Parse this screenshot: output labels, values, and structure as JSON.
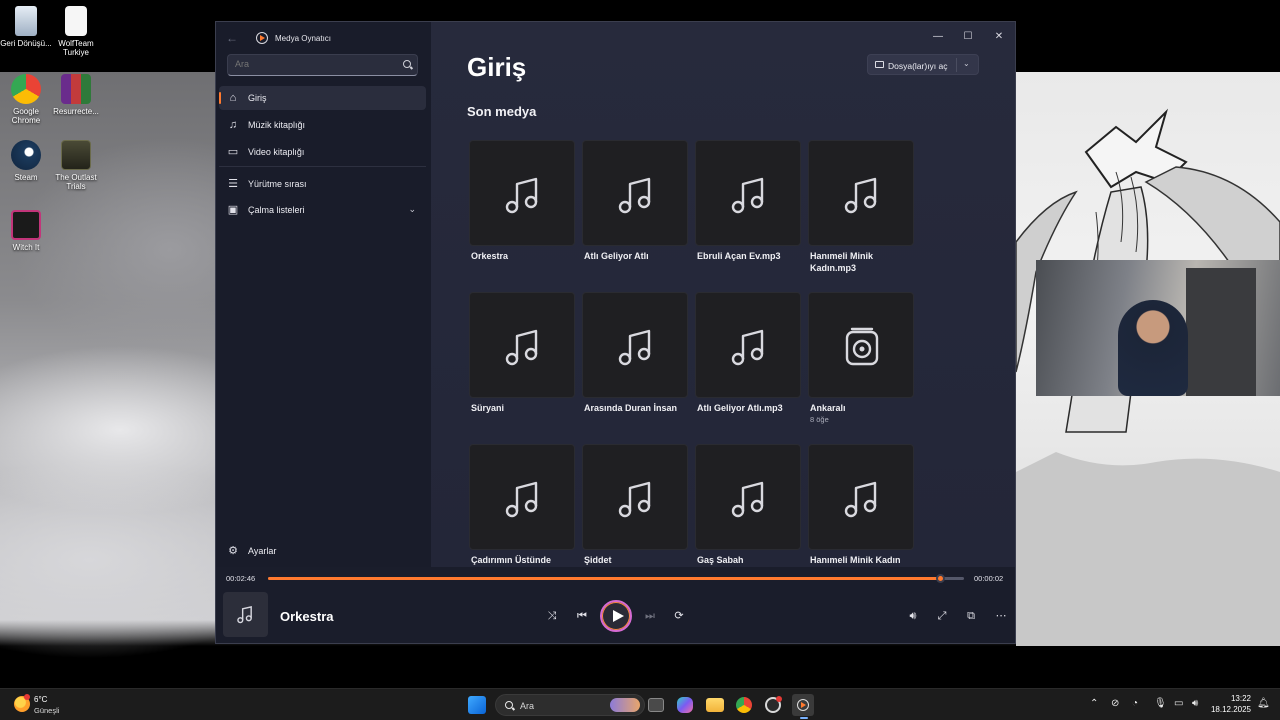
{
  "desktop": {
    "icons": [
      {
        "label": "Geri Dönüşü...",
        "color": "#c9d6e6"
      },
      {
        "label": "WolfTeam Turkiye",
        "color": "#f4f4f4"
      },
      {
        "label": "Google Chrome",
        "color": "#4285f4"
      },
      {
        "label": "Resurrecte...",
        "color": "#b32d5e"
      },
      {
        "label": "Steam",
        "color": "#1b3a5c"
      },
      {
        "label": "The Outlast Trials",
        "color": "#3a3a2a"
      },
      {
        "label": "Witch It",
        "color": "#7a1f4a"
      }
    ]
  },
  "window": {
    "app_title": "Medya Oynatıcı",
    "controls": {
      "minimize": "—",
      "maximize": "☐",
      "close": "✕"
    }
  },
  "sidebar": {
    "search_placeholder": "Ara",
    "items": [
      {
        "label": "Giriş",
        "icon": "home-icon",
        "active": true
      },
      {
        "label": "Müzik kitaplığı",
        "icon": "music-note-icon"
      },
      {
        "label": "Video kitaplığı",
        "icon": "video-icon"
      },
      {
        "label": "Yürütme sırası",
        "icon": "queue-icon"
      },
      {
        "label": "Çalma listeleri",
        "icon": "playlist-icon"
      }
    ],
    "settings_label": "Ayarlar"
  },
  "main": {
    "title": "Giriş",
    "open_files_label": "Dosya(lar)ıyı aç",
    "section_title": "Son medya",
    "tiles": [
      {
        "name": "Orkestra",
        "icon": "music-note-icon"
      },
      {
        "name": "Atlı Geliyor Atlı",
        "icon": "music-note-icon"
      },
      {
        "name": "Ebruli Açan Ev.mp3",
        "icon": "music-note-icon"
      },
      {
        "name": "Hanımeli Minik Kadın.mp3",
        "icon": "music-note-icon"
      },
      {
        "name": "Süryani",
        "icon": "music-note-icon"
      },
      {
        "name": "Arasında Duran İnsan",
        "icon": "music-note-icon"
      },
      {
        "name": "Atlı Geliyor Atlı.mp3",
        "icon": "music-note-icon"
      },
      {
        "name": "Ankaralı",
        "sub": "8 öğe",
        "icon": "album-icon"
      },
      {
        "name": "Çadırımın Üstünde",
        "icon": "music-note-icon"
      },
      {
        "name": "Şiddet",
        "icon": "music-note-icon"
      },
      {
        "name": "Gaş Sabah",
        "icon": "music-note-icon"
      },
      {
        "name": "Hanımeli Minik Kadın",
        "icon": "music-note-icon"
      }
    ]
  },
  "player": {
    "elapsed": "00:02:46",
    "remaining": "00:00:02",
    "progress": 0.985,
    "now_playing": "Orkestra",
    "accent": "#ff7a2f"
  },
  "taskbar": {
    "weather_temp": "6°C",
    "weather_desc": "Güneşli",
    "search_label": "Ara",
    "time": "13:22",
    "date": "18.12.2025"
  }
}
